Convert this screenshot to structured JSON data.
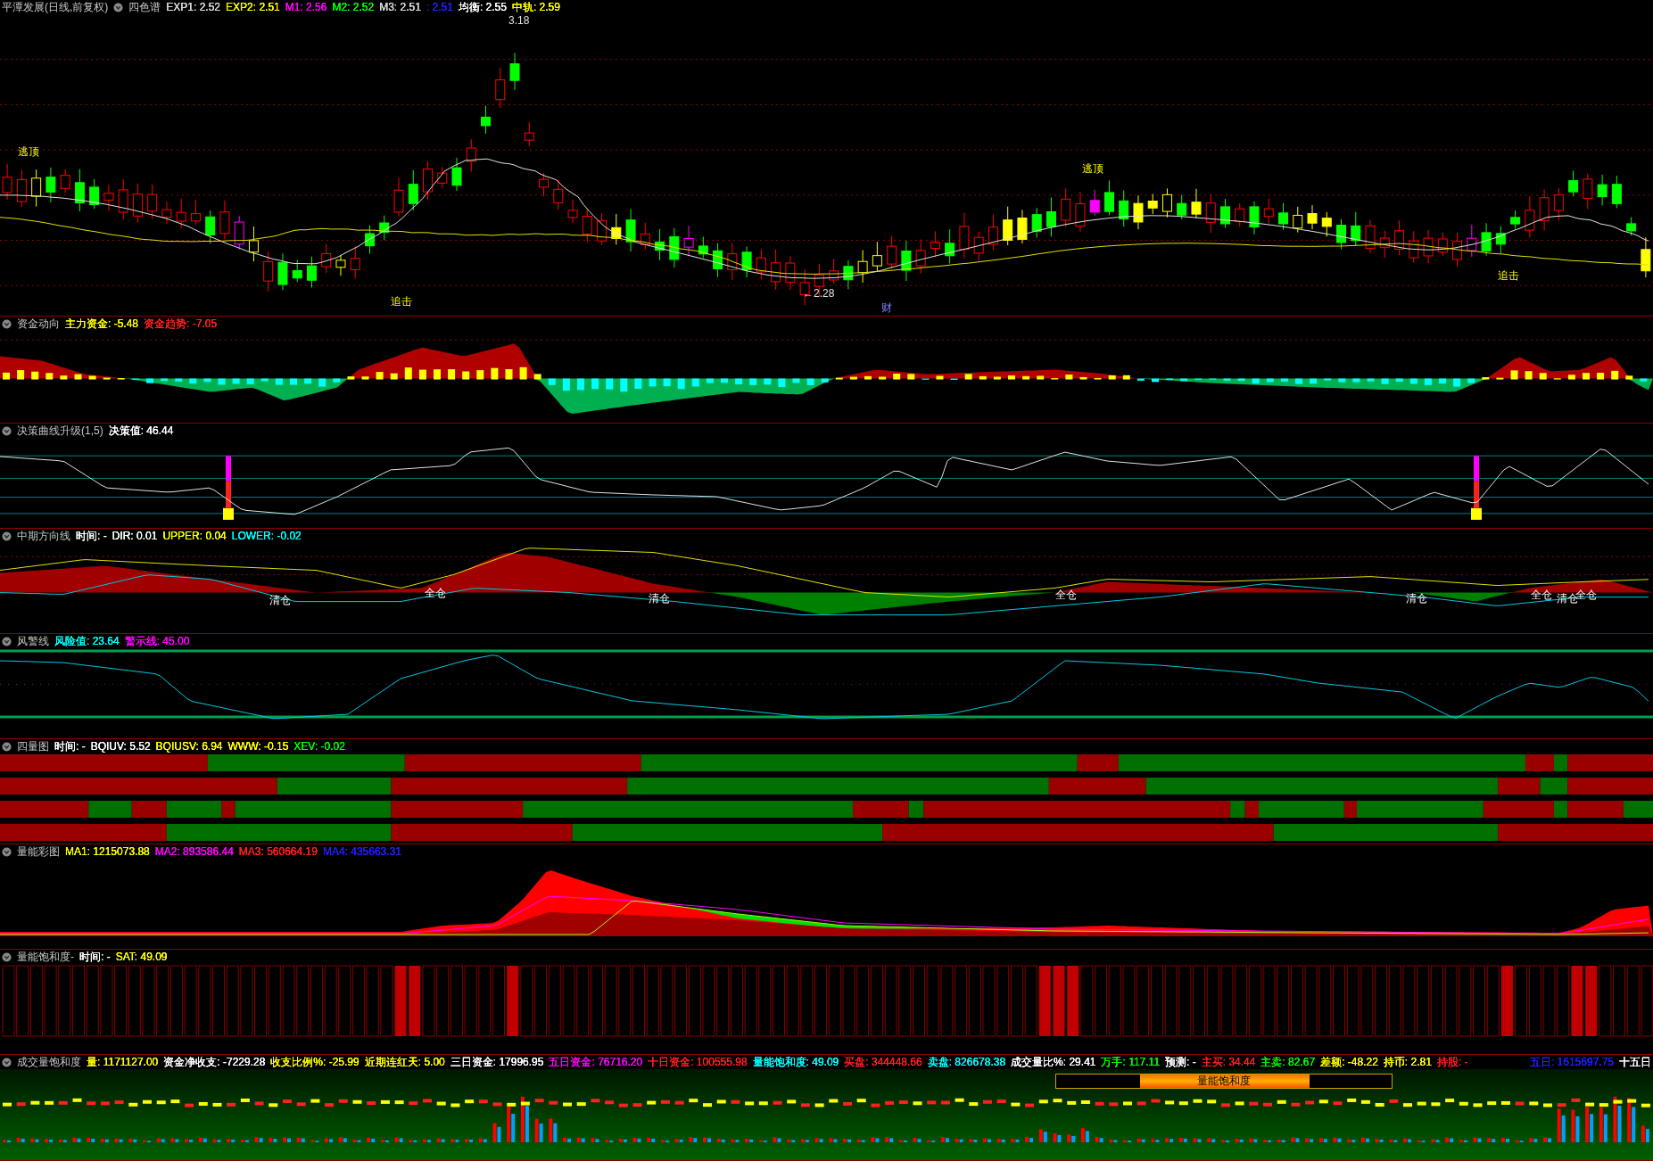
{
  "panes": [
    {
      "kind": "candles",
      "title": "平潭发展(日线,前复权)",
      "indicator": "四色谱",
      "readouts": [
        {
          "text": "EXP1: 2.52",
          "color": "#d8d8d8"
        },
        {
          "text": "EXP2: 2.51",
          "color": "#ffff00"
        },
        {
          "text": "M1: 2.56",
          "color": "#ff00ff"
        },
        {
          "text": "M2: 2.52",
          "color": "#00ff00"
        },
        {
          "text": "M3: 2.51",
          "color": "#d8d8d8"
        },
        {
          "text": ": 2.51",
          "color": "#2020ff"
        },
        {
          "text": "均衡: 2.55",
          "color": "#ffffff"
        },
        {
          "text": "中轨: 2.59",
          "color": "#ffff00"
        }
      ],
      "annotations": [
        "3.18",
        "逃顶",
        "逃顶",
        "追击",
        "追击",
        "←2.28",
        "财"
      ]
    },
    {
      "kind": "fund",
      "title": "资金动向",
      "readouts": [
        {
          "text": "主力资金: -5.48",
          "color": "#ffff00"
        },
        {
          "text": "资金趋势: -7.05",
          "color": "#ff2020"
        }
      ]
    },
    {
      "kind": "decision",
      "title": "决策曲线升级(1,5)",
      "readouts": [
        {
          "text": "决策值: 46.44",
          "color": "#ffffff"
        }
      ]
    },
    {
      "kind": "direction",
      "title": "中期方向线",
      "readouts": [
        {
          "text": "时间: -",
          "color": "#ffffff"
        },
        {
          "text": "DIR: 0.01",
          "color": "#ffffff"
        },
        {
          "text": "UPPER: 0.04",
          "color": "#ffff00"
        },
        {
          "text": "LOWER: -0.02",
          "color": "#00ffff"
        }
      ],
      "annotations": [
        "清仓",
        "全仓",
        "清仓",
        "全仓",
        "清仓",
        "全仓",
        "清仓",
        "全仓"
      ]
    },
    {
      "kind": "risk",
      "title": "风警线",
      "readouts": [
        {
          "text": "风险值: 23.64",
          "color": "#00ffff"
        },
        {
          "text": "警示线: 45.00",
          "color": "#ff00ff"
        }
      ]
    },
    {
      "kind": "quad",
      "title": "四量图",
      "readouts": [
        {
          "text": "时间: -",
          "color": "#ffffff"
        },
        {
          "text": "BQIUV: 5.52",
          "color": "#ffffff"
        },
        {
          "text": "BQIUSV: 6.94",
          "color": "#ffff00"
        },
        {
          "text": "WWW: -0.15",
          "color": "#ffff00"
        },
        {
          "text": "XEV: -0.02",
          "color": "#00ff00"
        }
      ]
    },
    {
      "kind": "volcolor",
      "title": "量能彩图",
      "readouts": [
        {
          "text": "MA1: 1215073.88",
          "color": "#ffff00"
        },
        {
          "text": "MA2: 893586.44",
          "color": "#ff00ff"
        },
        {
          "text": "MA3: 560664.19",
          "color": "#ff2020"
        },
        {
          "text": "MA4: 435663.31",
          "color": "#2020ff"
        }
      ]
    },
    {
      "kind": "saturation",
      "title": "量能饱和度-",
      "readouts": [
        {
          "text": "时间: -",
          "color": "#ffffff"
        },
        {
          "text": "SAT: 49.09",
          "color": "#ffff00"
        }
      ]
    },
    {
      "kind": "volume",
      "title": "成交量饱和度",
      "readouts": [
        {
          "text": "量: 1171127.00",
          "color": "#ffff00"
        },
        {
          "text": "资金净收支: -7229.28",
          "color": "#ffffff"
        },
        {
          "text": "收支比例%: -25.99",
          "color": "#ffff00"
        },
        {
          "text": "近期连红天: 5.00",
          "color": "#ffff00"
        },
        {
          "text": "三日资金: 17996.95",
          "color": "#ffffff"
        },
        {
          "text": "五日资金: 76716.20",
          "color": "#ff00ff"
        },
        {
          "text": "十日资金: 100555.98",
          "color": "#ff2020"
        },
        {
          "text": "量能饱和度: 49.09",
          "color": "#00ffff"
        },
        {
          "text": "买盘: 344448.66",
          "color": "#ff2020"
        },
        {
          "text": "卖盘: 826678.38",
          "color": "#00ffff"
        },
        {
          "text": "成交量比%: 29.41",
          "color": "#ffffff"
        },
        {
          "text": "万手: 117.11",
          "color": "#00ff00"
        },
        {
          "text": "预测: -",
          "color": "#ffffff"
        },
        {
          "text": "主买: 34.44",
          "color": "#ff2020"
        },
        {
          "text": "主卖: 82.67",
          "color": "#00ff00"
        },
        {
          "text": "差额: -48.22",
          "color": "#ffff00"
        },
        {
          "text": "持币: 2.81",
          "color": "#ffff00"
        },
        {
          "text": "持股: -",
          "color": "#ff2020"
        }
      ],
      "right_readouts": [
        {
          "text": "五日: 1615697.75",
          "color": "#2020ff"
        },
        {
          "text": "十五日",
          "color": "#ffffff"
        }
      ],
      "gauge_label": "量能饱和度"
    }
  ]
}
